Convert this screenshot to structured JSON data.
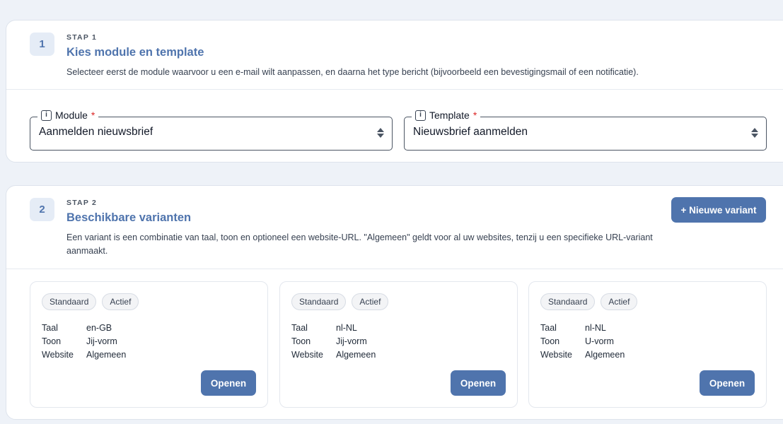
{
  "step1": {
    "number": "1",
    "label": "STAP 1",
    "title": "Kies module en template",
    "description": "Selecteer eerst de module waarvoor u een e-mail wilt aanpassen, en daarna het type bericht (bijvoorbeeld een bevestigingsmail of een notificatie).",
    "module": {
      "label": "Module",
      "required_mark": "*",
      "value": "Aanmelden nieuwsbrief"
    },
    "template": {
      "label": "Template",
      "required_mark": "*",
      "value": "Nieuwsbrief aanmelden"
    }
  },
  "step2": {
    "number": "2",
    "label": "STAP 2",
    "title": "Beschikbare varianten",
    "description": "Een variant is een combinatie van taal, toon en optioneel een website-URL. \"Algemeen\" geldt voor al uw websites, tenzij u een specifieke URL-variant aanmaakt.",
    "new_variant_label": "+ Nieuwe variant",
    "prop_labels": {
      "language": "Taal",
      "tone": "Toon",
      "website": "Website"
    },
    "open_label": "Openen",
    "variants": [
      {
        "badges": [
          "Standaard",
          "Actief"
        ],
        "language": "en-GB",
        "tone": "Jij-vorm",
        "website": "Algemeen"
      },
      {
        "badges": [
          "Standaard",
          "Actief"
        ],
        "language": "nl-NL",
        "tone": "Jij-vorm",
        "website": "Algemeen"
      },
      {
        "badges": [
          "Standaard",
          "Actief"
        ],
        "language": "nl-NL",
        "tone": "U-vorm",
        "website": "Algemeen"
      }
    ]
  },
  "icons": {
    "info": "info-icon",
    "select_arrows": "sort-arrows-icon"
  },
  "colors": {
    "accent": "#4f74ad",
    "background": "#eef2f8",
    "required": "#dc2626"
  }
}
